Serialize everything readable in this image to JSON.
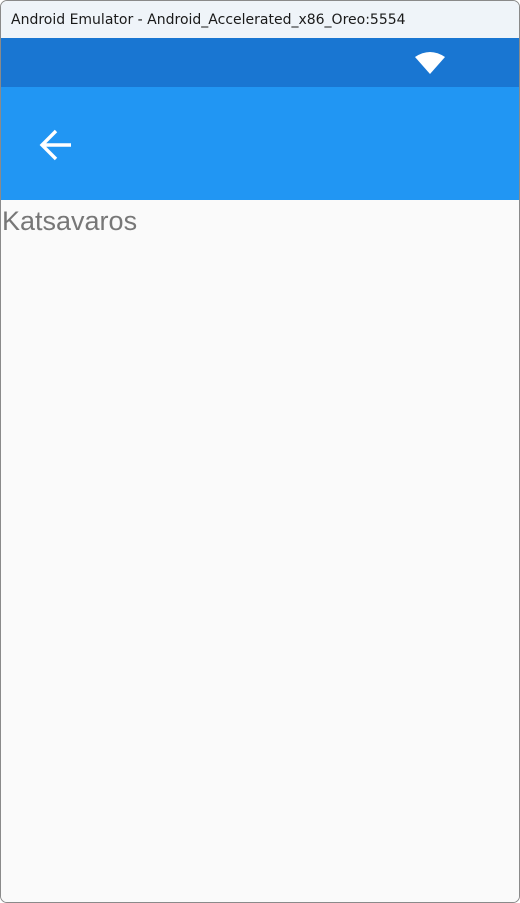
{
  "window": {
    "title": "Android Emulator - Android_Accelerated_x86_Oreo:5554"
  },
  "status_bar": {
    "icons": [
      "wifi-icon"
    ],
    "color": "#1976d2"
  },
  "app_bar": {
    "back_icon": "arrow-left-icon",
    "color": "#2196f3"
  },
  "content": {
    "text": "Katsavaros"
  }
}
